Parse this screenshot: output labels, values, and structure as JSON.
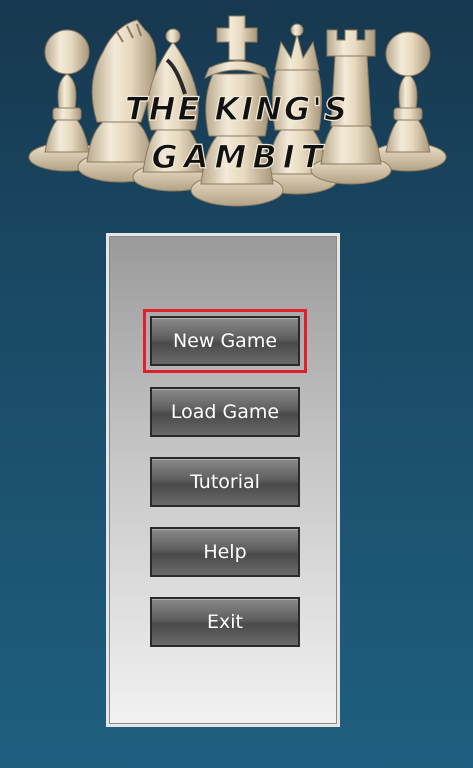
{
  "title": {
    "line1": "THE KING'S",
    "line2": "GAMBIT"
  },
  "menu": {
    "items": [
      {
        "label": "New Game",
        "selected": true
      },
      {
        "label": "Load Game",
        "selected": false
      },
      {
        "label": "Tutorial",
        "selected": false
      },
      {
        "label": "Help",
        "selected": false
      },
      {
        "label": "Exit",
        "selected": false
      }
    ],
    "selection_color": "#e0202a"
  },
  "colors": {
    "background_top": "#17384f",
    "background_bottom": "#1f5f7f",
    "piece_color": "#e8dcc6",
    "button_text": "#ffffff"
  },
  "logo_pieces": [
    "pawn",
    "knight",
    "bishop",
    "king",
    "queen",
    "rook",
    "pawn"
  ]
}
